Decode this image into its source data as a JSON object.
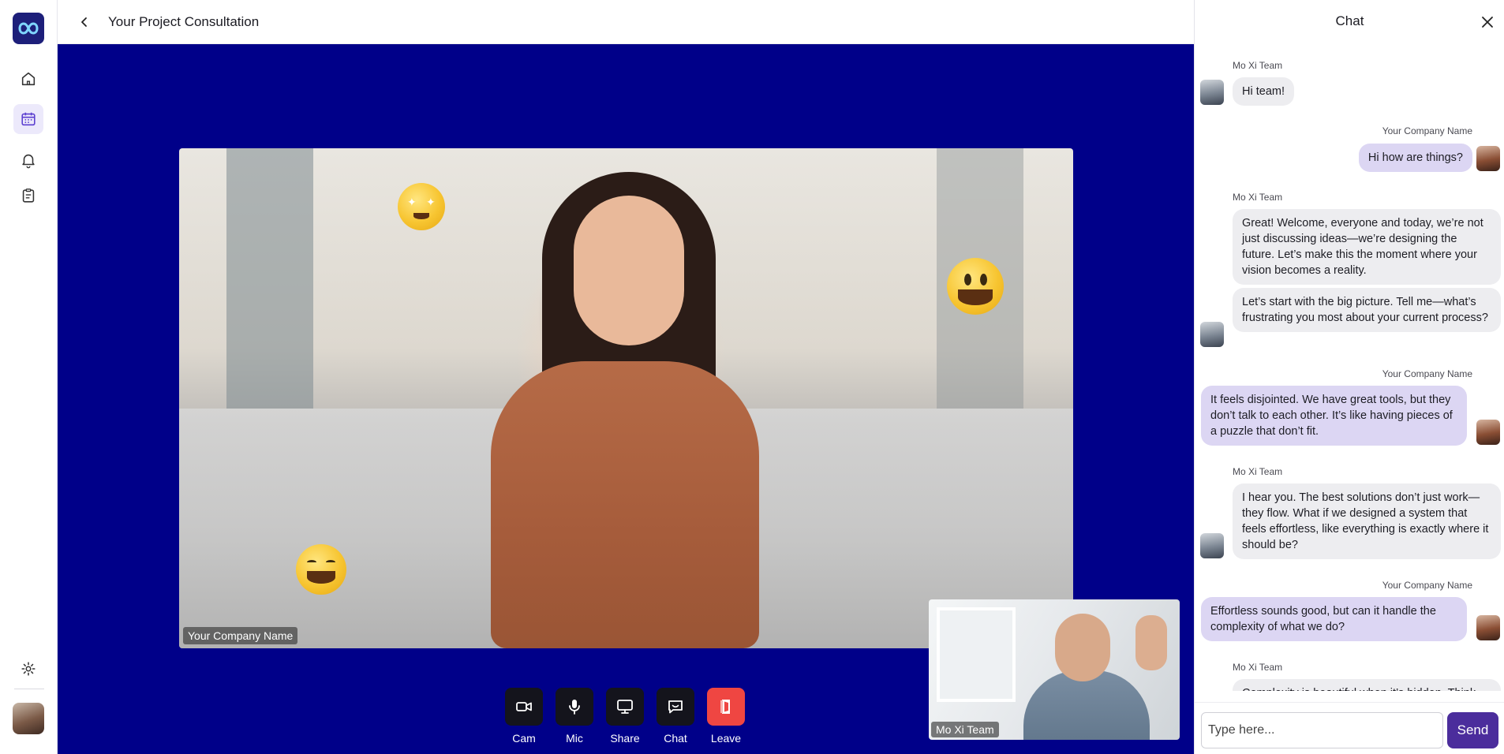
{
  "header": {
    "title": "Your Project Consultation"
  },
  "rail": {
    "items": [
      {
        "icon": "home-icon"
      },
      {
        "icon": "calendar-icon",
        "active": true
      },
      {
        "icon": "bell-icon"
      },
      {
        "icon": "clipboard-icon"
      }
    ],
    "settings_icon": "gear-icon"
  },
  "stage": {
    "main_label": "Your Company Name",
    "pip_label": "Mo Xi Team",
    "background_color": "#000089"
  },
  "controls": {
    "cam": "Cam",
    "mic": "Mic",
    "share": "Share",
    "chat": "Chat",
    "leave": "Leave",
    "leave_color": "#ef4642"
  },
  "chat": {
    "title": "Chat",
    "messages": [
      {
        "sender": "Mo Xi Team",
        "text": "Hi team!"
      },
      {
        "sender": "Your Company Name",
        "text": "Hi how are things?"
      },
      {
        "sender": "Mo Xi Team",
        "text": "Great! Welcome, everyone and today, we’re not just discussing ideas—we’re designing the future. Let’s make this the moment where your vision becomes a reality."
      },
      {
        "sender": "Mo Xi Team",
        "text": "Let’s start with the big picture. Tell me—what’s frustrating you most about your current process?"
      },
      {
        "sender": "Your Company Name",
        "text": "It feels disjointed. We have great tools, but they don’t talk to each other. It’s like having pieces of a puzzle that don’t fit."
      },
      {
        "sender": "Mo Xi Team",
        "text": "I hear you. The best solutions don’t just work—they flow. What if we designed a system that feels effortless, like everything is exactly where it should be?"
      },
      {
        "sender": "Your Company Name",
        "text": "Effortless sounds good, but can it handle the complexity of what we do?"
      },
      {
        "sender": "Mo Xi Team",
        "text": "Complexity is beautiful when it’s hidden. Think"
      }
    ],
    "input_placeholder": "Type here...",
    "send_label": "Send",
    "accent": "#4b2d9c"
  }
}
